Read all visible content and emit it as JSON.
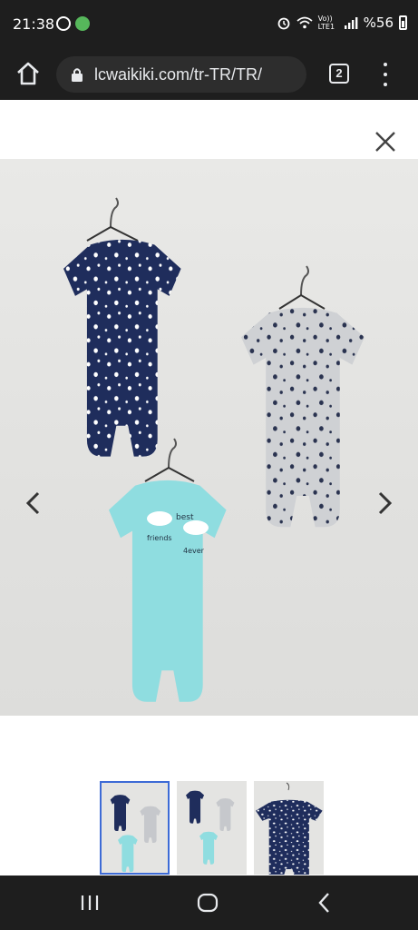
{
  "status_bar": {
    "time": "21:38",
    "network": "Vo)) LTE1",
    "battery_text": "%56",
    "icons": [
      "whatsapp-icon",
      "app-notification-icon",
      "alarm-icon",
      "wifi-icon",
      "signal-icon",
      "battery-icon"
    ]
  },
  "browser": {
    "url": "lcwaikiki.com/tr-TR/TR/",
    "tab_count": "2",
    "icons": [
      "home-icon",
      "lock-icon",
      "tabs-icon",
      "more-menu-icon"
    ]
  },
  "gallery": {
    "current_index": 1,
    "image_count": 3,
    "print_text": [
      "best",
      "friends",
      "4ever"
    ],
    "icons": [
      "close-icon",
      "chevron-left-icon",
      "chevron-right-icon"
    ]
  },
  "nav_bar": {
    "icons": [
      "recent-apps-icon",
      "home-icon",
      "back-icon"
    ]
  },
  "colors": {
    "system_bar": "#1e1e1e",
    "url_box": "#2d2d2d",
    "photo_bg": "#e4e4e2",
    "navy_romper": "#1f2d5c",
    "grey_romper": "#cfd1d4",
    "mint_romper": "#8fdde0",
    "thumb_selected": "#3d6bd6"
  }
}
